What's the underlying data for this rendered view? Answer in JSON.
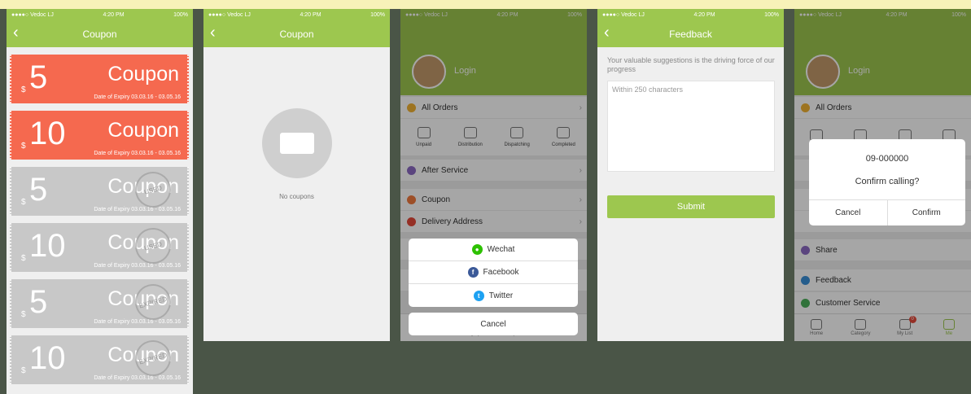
{
  "status": {
    "carrier": "●●●●○ Vedoc LJ",
    "time": "4:20 PM",
    "battery": "100%"
  },
  "coupon_screen": {
    "title": "Coupon",
    "coupons": [
      {
        "currency": "$",
        "amount": "5",
        "label": "Coupon",
        "expiry": "Date of Expiry  03.03.16 - 03.05.16",
        "state": "active"
      },
      {
        "currency": "$",
        "amount": "10",
        "label": "Coupon",
        "expiry": "Date of Expiry  03.03.16 - 03.05.16",
        "state": "active"
      },
      {
        "currency": "$",
        "amount": "5",
        "label": "Coupon",
        "expiry": "Date of Expiry  03.03.16 - 03.05.16",
        "state": "used",
        "stamp": "USED"
      },
      {
        "currency": "$",
        "amount": "10",
        "label": "Coupon",
        "expiry": "Date of Expiry  03.03.16 - 03.05.16",
        "state": "used",
        "stamp": "USED"
      },
      {
        "currency": "$",
        "amount": "5",
        "label": "Coupon",
        "expiry": "Date of Expiry  03.03.16 - 03.05.16",
        "state": "expired",
        "stamp": "EXPIRED"
      },
      {
        "currency": "$",
        "amount": "10",
        "label": "Coupon",
        "expiry": "Date of Expiry  03.03.16 - 03.05.16",
        "state": "expired",
        "stamp": "EXPIRED"
      }
    ]
  },
  "empty_screen": {
    "title": "Coupon",
    "empty_text": "No coupons"
  },
  "me_screen": {
    "login": "Login",
    "all_orders": "All Orders",
    "order_items": [
      "Unpaid",
      "Distribution",
      "Dispatching",
      "Completed"
    ],
    "after_service": "After Service",
    "coupon": "Coupon",
    "delivery_address": "Delivery Address",
    "share_options": [
      "Wechat",
      "Facebook",
      "Twitter"
    ],
    "cancel": "Cancel",
    "tabs": [
      "Home",
      "Category",
      "My List",
      "Me"
    ]
  },
  "feedback_screen": {
    "title": "Feedback",
    "hint": "Your valuable suggestions is the driving force of our progress",
    "placeholder": "Within 250 characters",
    "submit": "Submit"
  },
  "call_screen": {
    "login": "Login",
    "all_orders": "All Orders",
    "order_items": [
      "",
      "",
      "",
      ""
    ],
    "share": "Share",
    "feedback": "Feedback",
    "customer_service": "Customer Service",
    "dialog_number": "09-000000",
    "dialog_question": "Confirm calling?",
    "dialog_cancel": "Cancel",
    "dialog_confirm": "Confirm",
    "tabs": [
      "Home",
      "Category",
      "My List",
      "Me"
    ],
    "badge": "0"
  },
  "colors": {
    "accent": "#9dc74f",
    "coupon_red": "#f5694f",
    "coupon_gray": "#c8c8c8"
  }
}
